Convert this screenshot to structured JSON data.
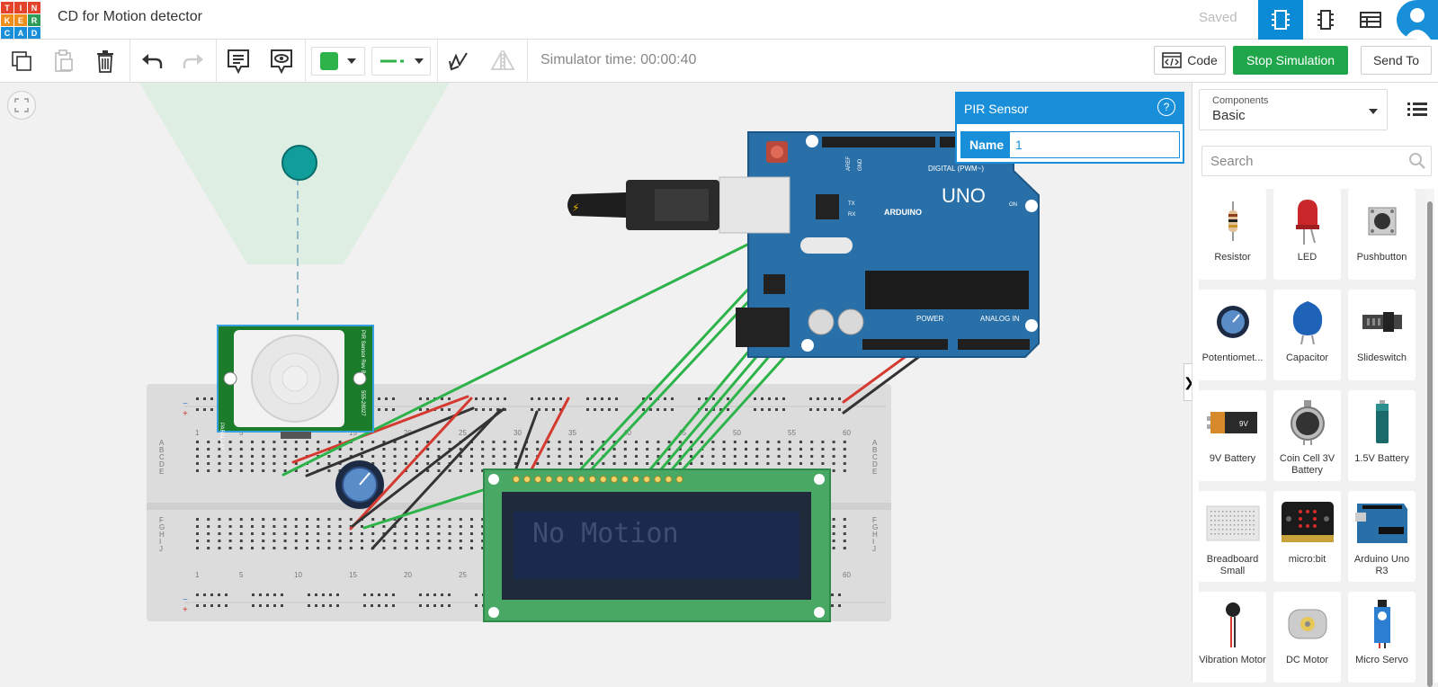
{
  "header": {
    "logo_letters": [
      "T",
      "I",
      "N",
      "K",
      "E",
      "R",
      "C",
      "A",
      "D"
    ],
    "title": "CD for Motion detector",
    "saved": "Saved"
  },
  "toolbar": {
    "simulator_time": "Simulator time: 00:00:40",
    "code_label": "Code",
    "stop_label": "Stop Simulation",
    "send_label": "Send To",
    "color": "#2db34a"
  },
  "popover": {
    "title": "PIR Sensor",
    "name_label": "Name",
    "name_value": "1"
  },
  "panel": {
    "select_label": "Components",
    "select_value": "Basic",
    "search_placeholder": "Search",
    "components": [
      {
        "label": "Resistor"
      },
      {
        "label": "LED"
      },
      {
        "label": "Pushbutton"
      },
      {
        "label": "Potentiomet..."
      },
      {
        "label": "Capacitor"
      },
      {
        "label": "Slideswitch"
      },
      {
        "label": "9V Battery"
      },
      {
        "label": "Coin Cell 3V Battery"
      },
      {
        "label": "1.5V Battery"
      },
      {
        "label": "Breadboard Small"
      },
      {
        "label": "micro:bit"
      },
      {
        "label": "Arduino Uno R3"
      },
      {
        "label": "Vibration Motor"
      },
      {
        "label": "DC Motor"
      },
      {
        "label": "Micro Servo"
      }
    ]
  },
  "circuit": {
    "lcd_text": "No Motion",
    "arduino_label": "UNO",
    "arduino_brand": "ARDUINO",
    "digital_label": "DIGITAL (PWM~)",
    "power_label": "POWER",
    "analog_label": "ANALOG IN",
    "on_label": "ON",
    "pir_label": "PIR Sensor Rev B",
    "pir_brand": "PARALLAX",
    "pir_part": "555-28027",
    "aref_label": "AREF",
    "gnd_label": "GND",
    "tx_label": "TX",
    "rx_label": "RX",
    "breadboard_columns": [
      "1",
      "5",
      "10",
      "15",
      "20",
      "25",
      "30",
      "35",
      "40",
      "45",
      "50",
      "55",
      "60"
    ],
    "breadboard_rows": [
      "A",
      "B",
      "C",
      "D",
      "E",
      "F",
      "G",
      "H",
      "I",
      "J"
    ]
  }
}
